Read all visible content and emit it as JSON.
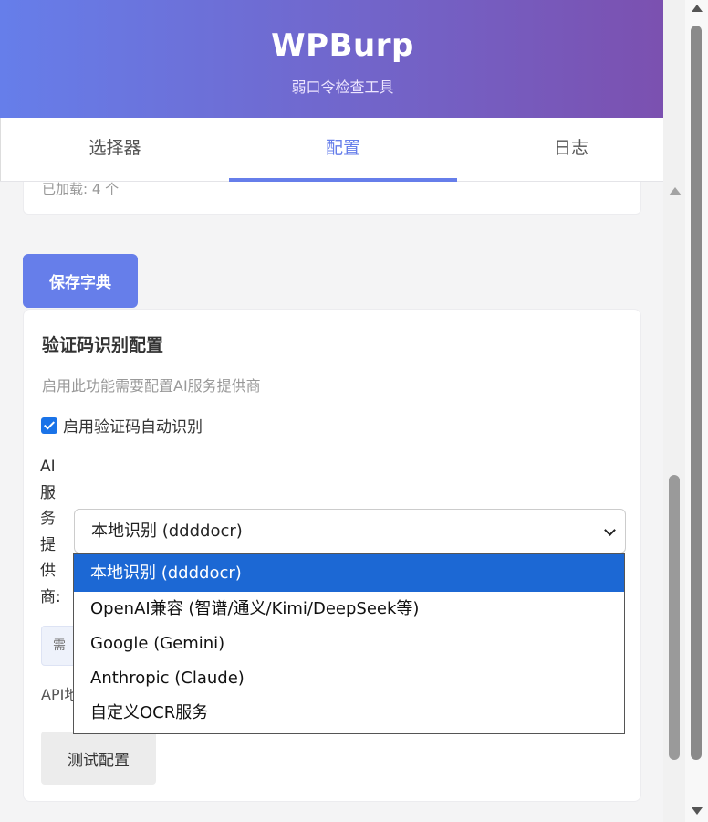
{
  "header": {
    "title": "WPBurp",
    "subtitle": "弱口令检查工具"
  },
  "tabs": [
    {
      "label": "选择器",
      "active": false
    },
    {
      "label": "配置",
      "active": true
    },
    {
      "label": "日志",
      "active": false
    }
  ],
  "dict_card": {
    "loaded_text": "已加载: 4 个"
  },
  "save_button_label": "保存字典",
  "captcha": {
    "heading": "验证码识别配置",
    "description": "启用此功能需要配置AI服务提供商",
    "enable_checkbox_label": "启用验证码自动识别",
    "enable_checked": true,
    "provider_label": "AI服务提供商:",
    "provider_selected": "本地识别 (ddddocr)",
    "provider_options": [
      "本地识别 (ddddocr)",
      "OpenAI兼容 (智谱/通义/Kimi/DeepSeek等)",
      "Google (Gemini)",
      "Anthropic (Claude)",
      "自定义OCR服务"
    ],
    "hint_text": "需",
    "api_label": "API地",
    "test_button_label": "测试配置"
  },
  "colors": {
    "accent": "#667eea",
    "gradient_end": "#7c4fae",
    "option_highlight": "#1c68d4"
  }
}
